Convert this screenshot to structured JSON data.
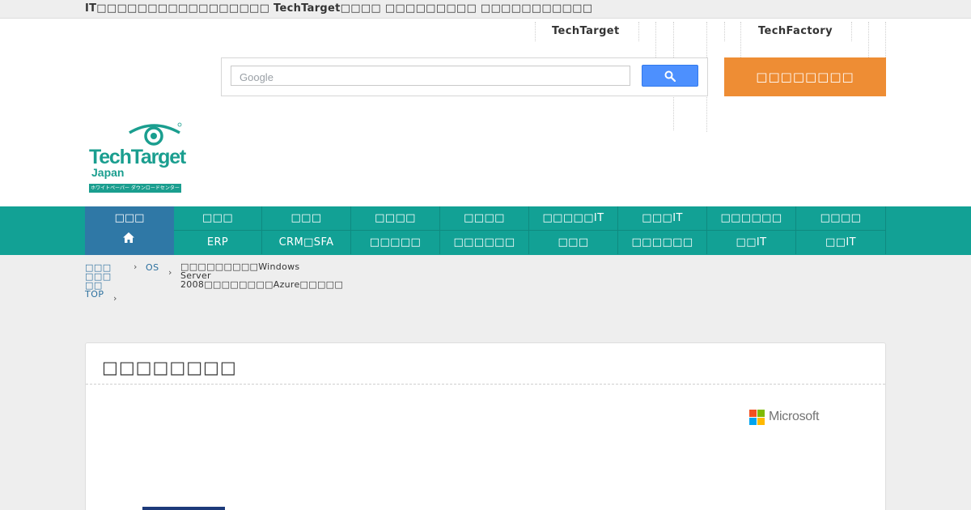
{
  "topbar": {
    "text": "IT□□□□□□□□□□□□□□□□□ TechTarget□□□□ □□□□□□□□□ □□□□□□□□□□□"
  },
  "header": {
    "links": {
      "techtarget": "TechTarget",
      "techfactory": "TechFactory"
    },
    "search": {
      "placeholder": "Google"
    },
    "orange_button": "□□□□□□□□"
  },
  "logo": {
    "name": "TechTarget",
    "sub": "Japan",
    "band": "ホワイトペーパー ダウンロードセンター"
  },
  "nav": {
    "home": "□□□",
    "row1": [
      "□□□",
      "□□□",
      "□□□□",
      "□□□□",
      "□□□□□IT",
      "□□□IT",
      "□□□□□□",
      "□□□□"
    ],
    "row2": [
      "ERP",
      "CRM□SFA",
      "□□□□□",
      "□□□□□□",
      "□□□",
      "□□□□□□",
      "□□IT",
      "□□IT"
    ]
  },
  "breadcrumb": {
    "top_lines": [
      "□□□",
      "□□□",
      "□□",
      "TOP"
    ],
    "os": "OS",
    "current_lines": [
      "□□□□□□□□□Windows Server",
      "2008□□□□□□□□Azure□□□□□"
    ]
  },
  "card": {
    "title": "□□□□□□□□",
    "brand": "Microsoft",
    "brand_colors": [
      "#f25022",
      "#7fba00",
      "#00a4ef",
      "#ffb900"
    ]
  },
  "colors": {
    "teal": "#12a195",
    "home_blue": "#2f78a6",
    "orange": "#ee8d34",
    "google_blue": "#4d90fe"
  }
}
